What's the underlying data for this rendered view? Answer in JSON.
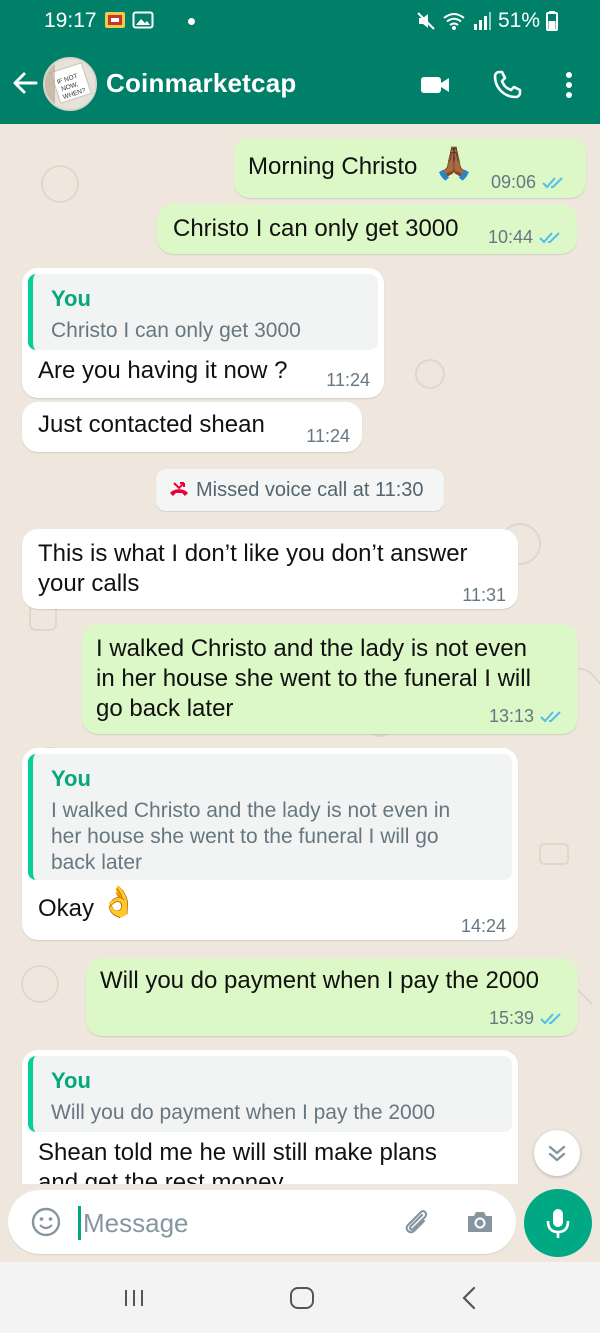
{
  "status_bar": {
    "time": "19:17",
    "battery": "51%"
  },
  "header": {
    "contact_name": "Coinmarketcap",
    "avatar_text": "IF NOT NOW, WHEN?"
  },
  "messages": [
    {
      "dir": "out",
      "text": "Morning Christo",
      "emoji": "🙏🏾",
      "time": "09:06",
      "ticks": "read"
    },
    {
      "dir": "out",
      "text": "Christo I can only get 3000",
      "time": "10:44",
      "ticks": "read"
    },
    {
      "dir": "in",
      "quote_name": "You",
      "quote_text": "Christo I can only get 3000",
      "text": "Are you having it now  ?",
      "time": "11:24"
    },
    {
      "dir": "in",
      "text": "Just contacted shean",
      "time": "11:24"
    },
    {
      "type": "system",
      "text": "Missed voice call at 11:30"
    },
    {
      "dir": "in",
      "text_lines": [
        "This is what I don’t like you don’t answer",
        "your calls"
      ],
      "time": "11:31"
    },
    {
      "dir": "out",
      "text_lines": [
        "I walked Christo and the lady is not even",
        "in her house she went to the funeral I will",
        "go back later"
      ],
      "time": "13:13",
      "ticks": "read"
    },
    {
      "dir": "in",
      "quote_name": "You",
      "quote_lines": [
        "I walked Christo and the lady is not even in",
        "her house she went to the funeral I will go",
        "back later"
      ],
      "text": "Okay",
      "emoji": "👌",
      "time": "14:24"
    },
    {
      "dir": "out",
      "text": "Will you do payment when I pay the 2000",
      "time": "15:39",
      "ticks": "read"
    },
    {
      "dir": "in",
      "quote_name": "You",
      "quote_text": "Will you do payment when I pay the 2000",
      "text_lines": [
        "Shean told me he will still make plans",
        "and get the rest money"
      ]
    }
  ],
  "composer": {
    "placeholder": "Message"
  },
  "colors": {
    "header": "#008069",
    "outgoing": "#dcf8c6",
    "incoming": "#ffffff",
    "accent": "#00a884",
    "read_ticks": "#53bdeb"
  },
  "icons": [
    "back-arrow-icon",
    "video-call-icon",
    "phone-icon",
    "more-vert-icon",
    "emoji-icon",
    "attach-icon",
    "camera-icon",
    "mic-icon",
    "scroll-down-icon",
    "missed-call-icon",
    "read-ticks-icon"
  ]
}
